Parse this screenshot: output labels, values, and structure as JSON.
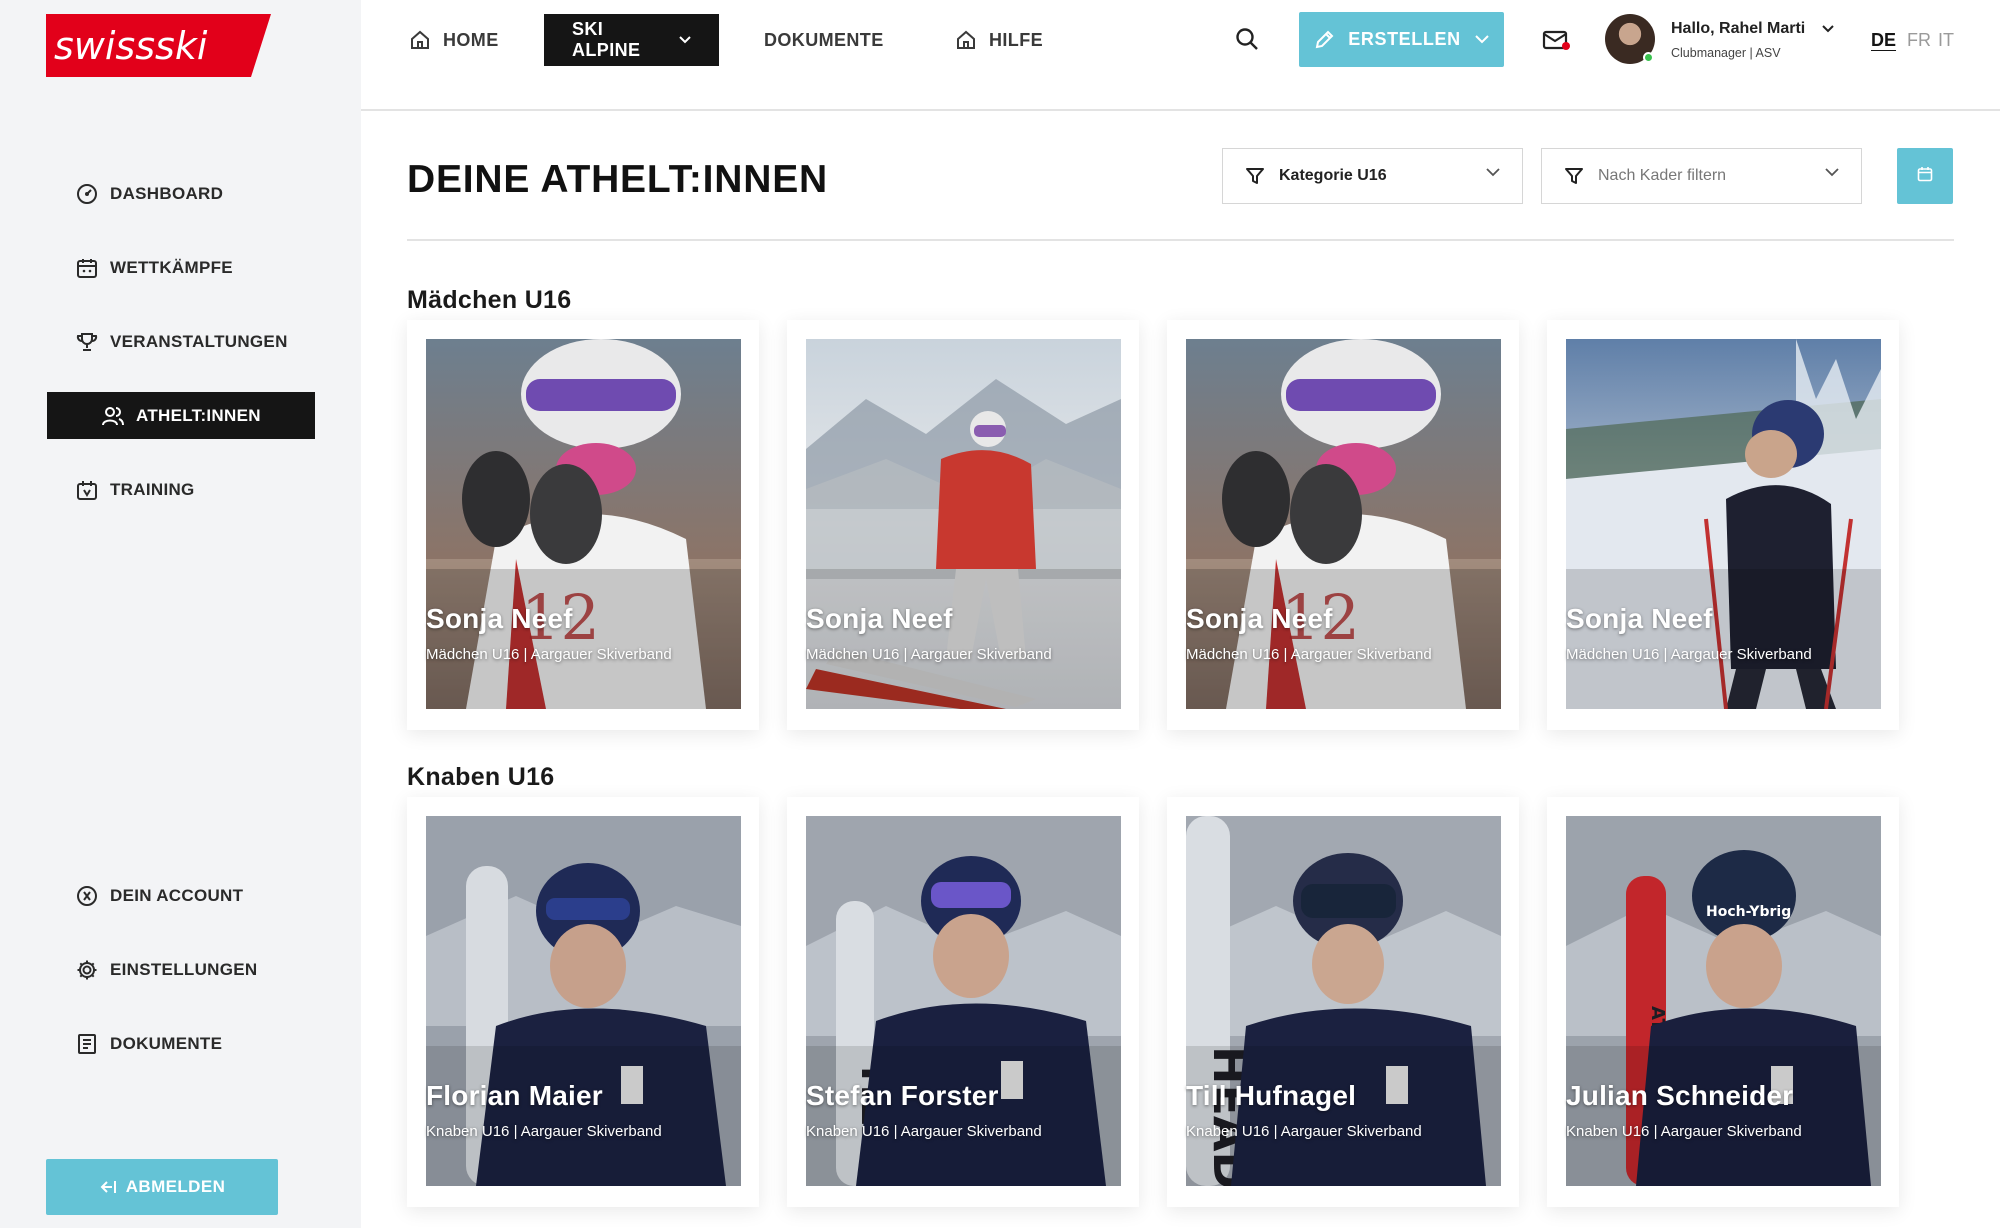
{
  "brand": {
    "logo_text": "swissski",
    "color": "#e2001a"
  },
  "sidebar": {
    "items": [
      {
        "label": "DASHBOARD",
        "icon": "dashboard-icon"
      },
      {
        "label": "WETTKÄMPFE",
        "icon": "calendar-icon"
      },
      {
        "label": "VERANSTALTUNGEN",
        "icon": "trophy-icon"
      },
      {
        "label": "ATHELT:INNEN",
        "icon": "users-icon",
        "active": true
      },
      {
        "label": "TRAINING",
        "icon": "training-icon"
      },
      {
        "label": "DEIN ACCOUNT",
        "icon": "account-icon"
      },
      {
        "label": "EINSTELLUNGEN",
        "icon": "gear-icon"
      },
      {
        "label": "DOKUMENTE",
        "icon": "document-icon"
      }
    ],
    "logout_label": "ABMELDEN"
  },
  "topbar": {
    "home_label": "HOME",
    "ski_alpine_label": "SKI ALPINE",
    "dokumente_label": "DOKUMENTE",
    "hilfe_label": "HILFE",
    "create_label": "ERSTELLEN",
    "user_greeting": "Hallo, Rahel Marti",
    "user_role": "Clubmanager | ASV",
    "languages": [
      "DE",
      "FR",
      "IT"
    ],
    "active_language": "DE"
  },
  "main": {
    "title": "DEINE ATHELT:INNEN",
    "filter_category": "Kategorie U16",
    "filter_kader_placeholder": "Nach Kader filtern",
    "sections": [
      {
        "title": "Mädchen U16",
        "athletes": [
          {
            "name": "Sonja Neef",
            "subtitle": "Mädchen U16 | Aargauer Skiverband"
          },
          {
            "name": "Sonja Neef",
            "subtitle": "Mädchen U16 | Aargauer Skiverband"
          },
          {
            "name": "Sonja Neef",
            "subtitle": "Mädchen U16 | Aargauer Skiverband"
          },
          {
            "name": "Sonja Neef",
            "subtitle": "Mädchen U16 | Aargauer Skiverband"
          }
        ]
      },
      {
        "title": "Knaben U16",
        "athletes": [
          {
            "name": "Florian Maier",
            "subtitle": "Knaben U16 | Aargauer Skiverband"
          },
          {
            "name": "Stefan Forster",
            "subtitle": "Knaben U16 | Aargauer Skiverband"
          },
          {
            "name": "Till Hufnagel",
            "subtitle": "Knaben U16 | Aargauer Skiverband"
          },
          {
            "name": "Julian Schneider",
            "subtitle": "Knaben U16 | Aargauer Skiverband"
          }
        ]
      }
    ]
  },
  "colors": {
    "accent": "#64c3d6",
    "dark": "#151515",
    "sidebar_bg": "#f3f4f6"
  }
}
